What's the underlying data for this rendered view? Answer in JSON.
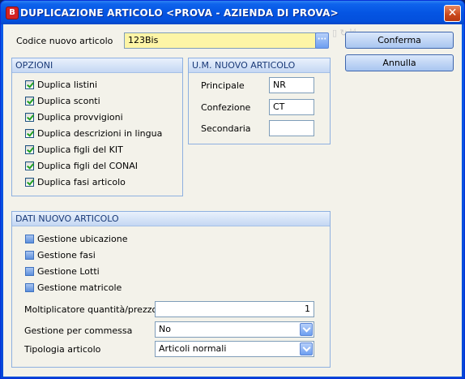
{
  "window": {
    "title": "DUPLICAZIONE ARTICOLO <PROVA - AZIENDA DI PROVA>",
    "app_icon_letter": "B"
  },
  "code": {
    "label": "Codice nuovo articolo",
    "value": "123Bis",
    "lookup_button": "···"
  },
  "buttons": {
    "confirm": "Conferma",
    "cancel": "Annulla"
  },
  "options": {
    "title": "OPZIONI",
    "items": [
      {
        "label": "Duplica listini",
        "checked": true
      },
      {
        "label": "Duplica sconti",
        "checked": true
      },
      {
        "label": "Duplica provvigioni",
        "checked": true
      },
      {
        "label": "Duplica descrizioni in lingua",
        "checked": true
      },
      {
        "label": "Duplica figli del KIT",
        "checked": true
      },
      {
        "label": "Duplica figli del CONAI",
        "checked": true
      },
      {
        "label": "Duplica fasi articolo",
        "checked": true
      }
    ]
  },
  "um": {
    "title": "U.M. NUOVO ARTICOLO",
    "principale_label": "Principale",
    "principale_value": "NR",
    "confezione_label": "Confezione",
    "confezione_value": "CT",
    "secondaria_label": "Secondaria",
    "secondaria_value": ""
  },
  "dati": {
    "title": "DATI NUOVO ARTICOLO",
    "checks": [
      {
        "label": "Gestione ubicazione",
        "checked": false
      },
      {
        "label": "Gestione fasi",
        "checked": false
      },
      {
        "label": "Gestione Lotti",
        "checked": false
      },
      {
        "label": "Gestione matricole",
        "checked": false
      }
    ],
    "multiplier_label": "Moltiplicatore quantità/prezzo",
    "multiplier_value": "1",
    "commessa_label": "Gestione per commessa",
    "commessa_value": "No",
    "tipologia_label": "Tipologia articolo",
    "tipologia_value": "Articoli normali"
  },
  "colors": {
    "titlebar": "#0555e3",
    "group_border": "#8eb0e0",
    "code_field": "#fdf5a6"
  }
}
